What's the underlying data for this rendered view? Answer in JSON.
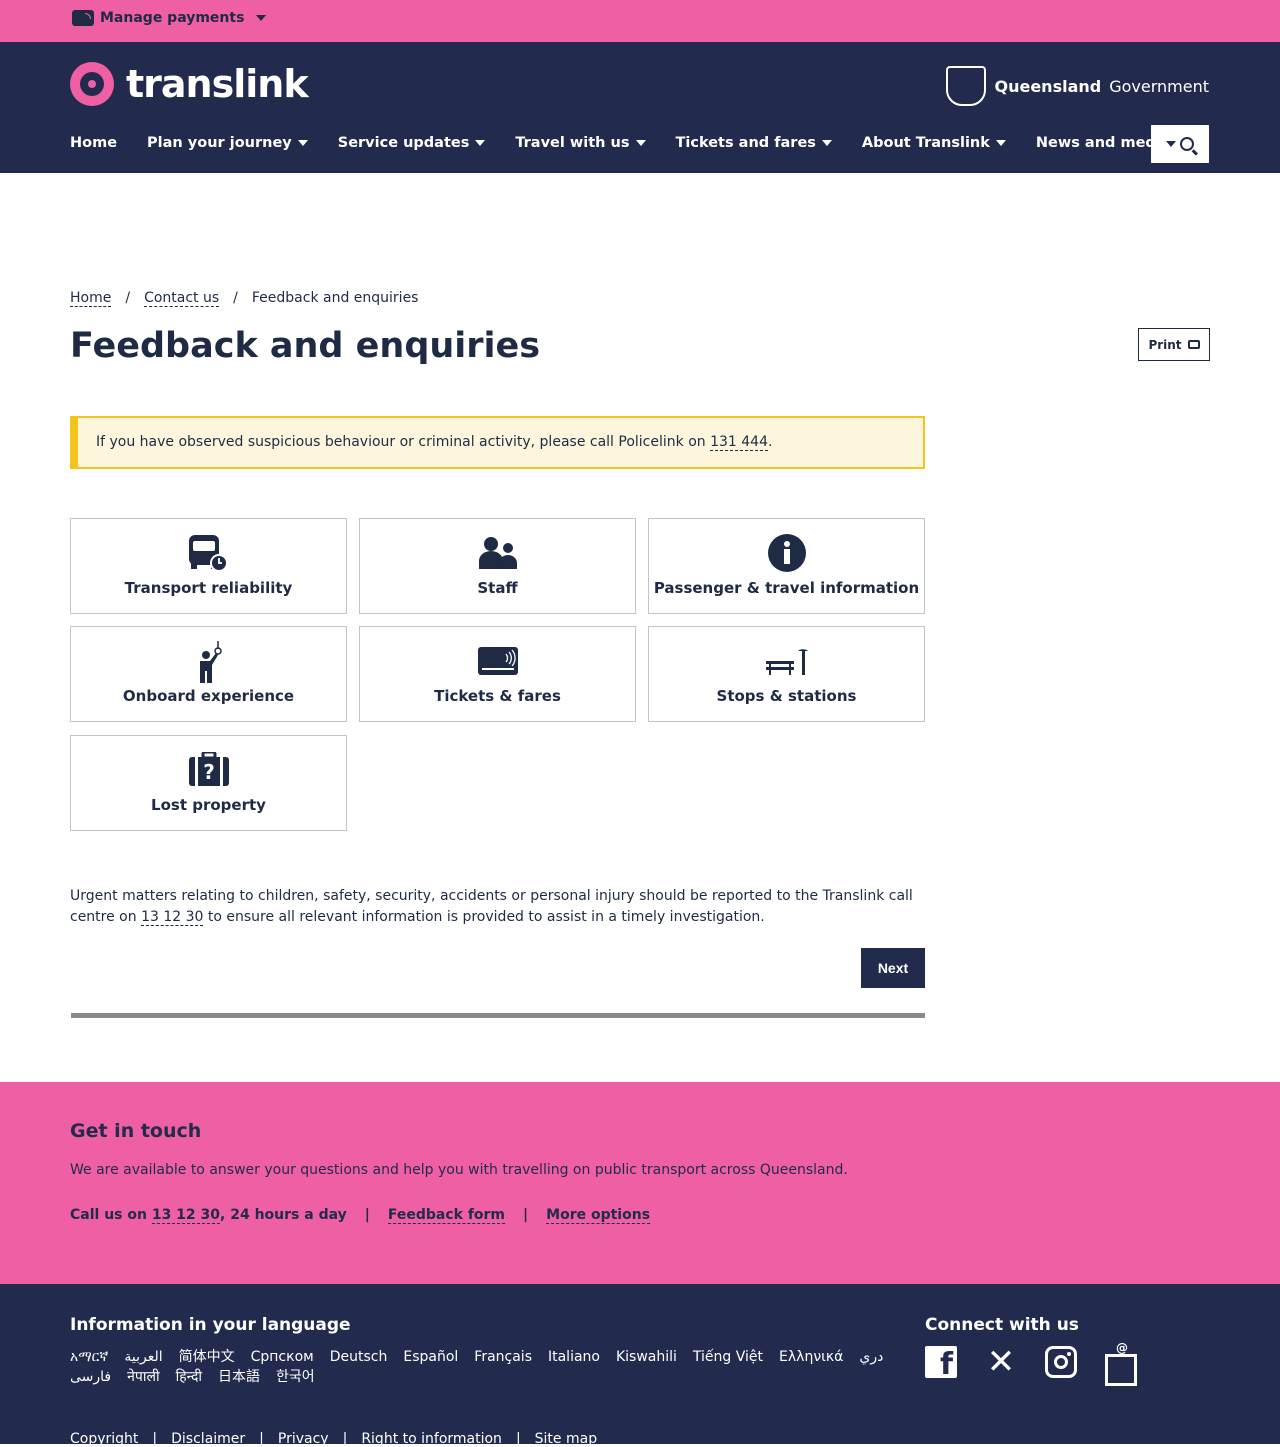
{
  "top_bar": {
    "manage_payments": "Manage payments"
  },
  "header": {
    "logo_text": "translink",
    "gov_bold": "Queensland",
    "gov_rest": "Government",
    "nav": [
      "Home",
      "Plan your journey",
      "Service updates",
      "Travel with us",
      "Tickets and fares",
      "About Translink",
      "News and media"
    ]
  },
  "breadcrumb": {
    "home": "Home",
    "sep1": "/",
    "contact": "Contact us",
    "sep2": "/",
    "current": "Feedback and enquiries"
  },
  "page": {
    "title": "Feedback and enquiries",
    "print_label": "Print",
    "alert_text": "If you have observed suspicious behaviour or criminal activity, please call Policelink on ",
    "alert_phone": "131 444",
    "alert_end": ".",
    "tiles": [
      {
        "label": "Transport reliability",
        "icon": "bus-clock-icon"
      },
      {
        "label": "Staff",
        "icon": "staff-icon"
      },
      {
        "label": "Passenger & travel information",
        "icon": "info-icon"
      },
      {
        "label": "Onboard experience",
        "icon": "standing-passenger-icon"
      },
      {
        "label": "Tickets & fares",
        "icon": "go-card-icon"
      },
      {
        "label": "Stops & stations",
        "icon": "bench-icon"
      },
      {
        "label": "Lost property",
        "icon": "suitcase-question-icon"
      }
    ],
    "urgent_text": "Urgent matters relating to children, safety, security, accidents or personal injury should be reported to the Translink call centre on ",
    "urgent_phone": "13 12 30",
    "urgent_end": " to ensure all relevant information is provided to assist in a timely investigation.",
    "next_label": "Next"
  },
  "get_in_touch": {
    "heading": "Get in touch",
    "text": "We are available to answer your questions and help you with travelling on public transport across Queensland.",
    "call_prefix": "Call us on ",
    "call_phone": "13 12 30",
    "call_suffix": ", 24 hours a day",
    "separator": "|",
    "feedback_form": "Feedback form",
    "more_options": "More options"
  },
  "footer": {
    "language_heading": "Information in your language",
    "languages": [
      "አማርኛ",
      "العربية",
      "简体中文",
      "Српском",
      "Deutsch",
      "Español",
      "Français",
      "Italiano",
      "Kiswahili",
      "Tiếng Việt",
      "Ελληνικά",
      "دري",
      "فارسی",
      "नेपाली",
      "हिन्दी",
      "日本語",
      "한국어"
    ],
    "connect_heading": "Connect with us",
    "social": [
      "facebook-icon",
      "x-icon",
      "instagram-icon",
      "email-icon"
    ],
    "legal": [
      "Copyright",
      "Disclaimer",
      "Privacy",
      "Right to information",
      "Site map"
    ]
  },
  "colors": {
    "pink": "#ef5fa3",
    "navy": "#222b4d",
    "alert_bg": "#fdf6dc",
    "alert_border": "#f3c51c"
  }
}
